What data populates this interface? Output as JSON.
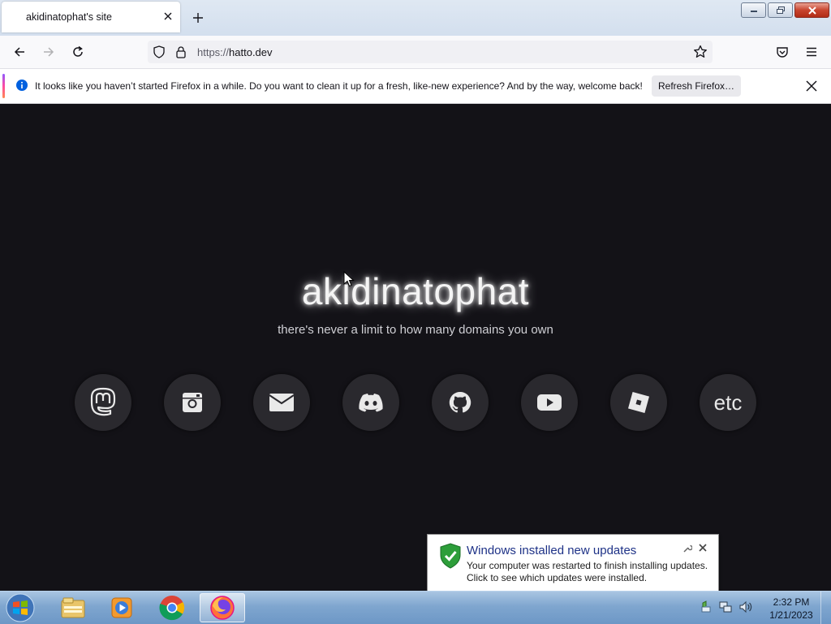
{
  "window": {
    "tab_title": "akidinatophat's site",
    "controls": {
      "minimize_icon": "minimize-icon",
      "restore_icon": "restore-icon",
      "close_icon": "close-icon"
    }
  },
  "nav": {
    "url_scheme": "https://",
    "url_host": "hatto.dev"
  },
  "notification": {
    "message": "It looks like you haven’t started Firefox in a while. Do you want to clean it up for a fresh, like-new experience? And by the way, welcome back!",
    "button_label": "Refresh Firefox…",
    "accent_colors": [
      "#9059ff",
      "#ff4aa2",
      "#ff8a50"
    ]
  },
  "page": {
    "title": "akidinatophat",
    "subtitle": "there's never a limit to how many domains you own",
    "links": [
      {
        "icon": "mastodon-icon"
      },
      {
        "icon": "instagram-icon"
      },
      {
        "icon": "email-icon"
      },
      {
        "icon": "discord-icon"
      },
      {
        "icon": "github-icon"
      },
      {
        "icon": "youtube-icon"
      },
      {
        "icon": "roblox-icon"
      },
      {
        "label": "etc"
      }
    ],
    "background": "#131217"
  },
  "balloon": {
    "title": "Windows installed new updates",
    "line1": "Your computer was restarted to finish installing updates.",
    "line2": "Click to see which updates were installed."
  },
  "taskbar": {
    "apps": [
      "windows-explorer-icon",
      "media-player-icon",
      "chrome-icon",
      "firefox-icon"
    ],
    "time": "2:32 PM",
    "date": "1/21/2023"
  }
}
